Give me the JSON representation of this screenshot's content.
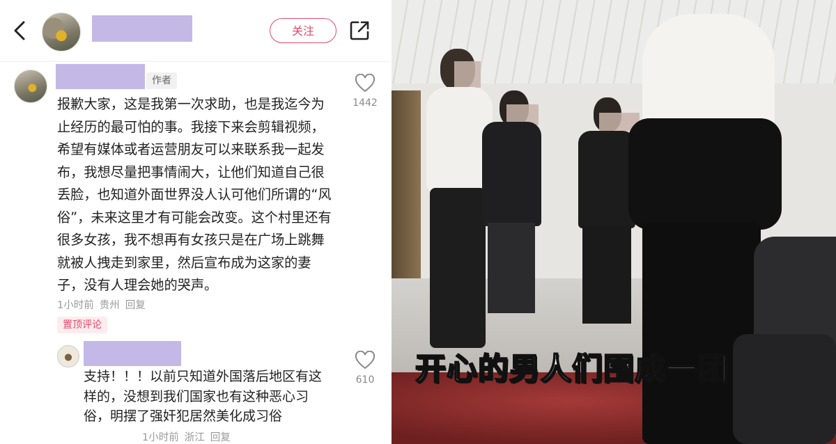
{
  "header": {
    "follow_label": "关注"
  },
  "comment_main": {
    "author_tag": "作者",
    "text": "报歉大家，这是我第一次求助，也是我迄今为止经历的最可怕的事。我接下来会剪辑视频，希望有媒体或者运营朋友可以来联系我一起发布，我想尽量把事情闹大，让他们知道自己很丢脸，也知道外面世界没人认可他们所谓的“风俗”，未来这里才有可能会改变。这个村里还有很多女孩，我不想再有女孩只是在广场上跳舞就被人拽走到家里，然后宣布成为这家的妻子，没有人理会她的哭声。",
    "time": "1小时前",
    "location": "贵州",
    "reply_label": "回复",
    "likes": "1442",
    "pinned_label": "置顶评论"
  },
  "comment_reply": {
    "text": "支持！！！以前只知道外国落后地区有这样的，没想到我们国家也有这种恶心习俗，明摆了强奸犯居然美化成习俗",
    "time": "1小时前",
    "location": "浙江",
    "reply_label": "回复",
    "likes": "610"
  },
  "photo": {
    "caption": "开心的男人们围成一团"
  },
  "colors": {
    "accent": "#e24a6c",
    "redaction": "#c4b8e6"
  }
}
